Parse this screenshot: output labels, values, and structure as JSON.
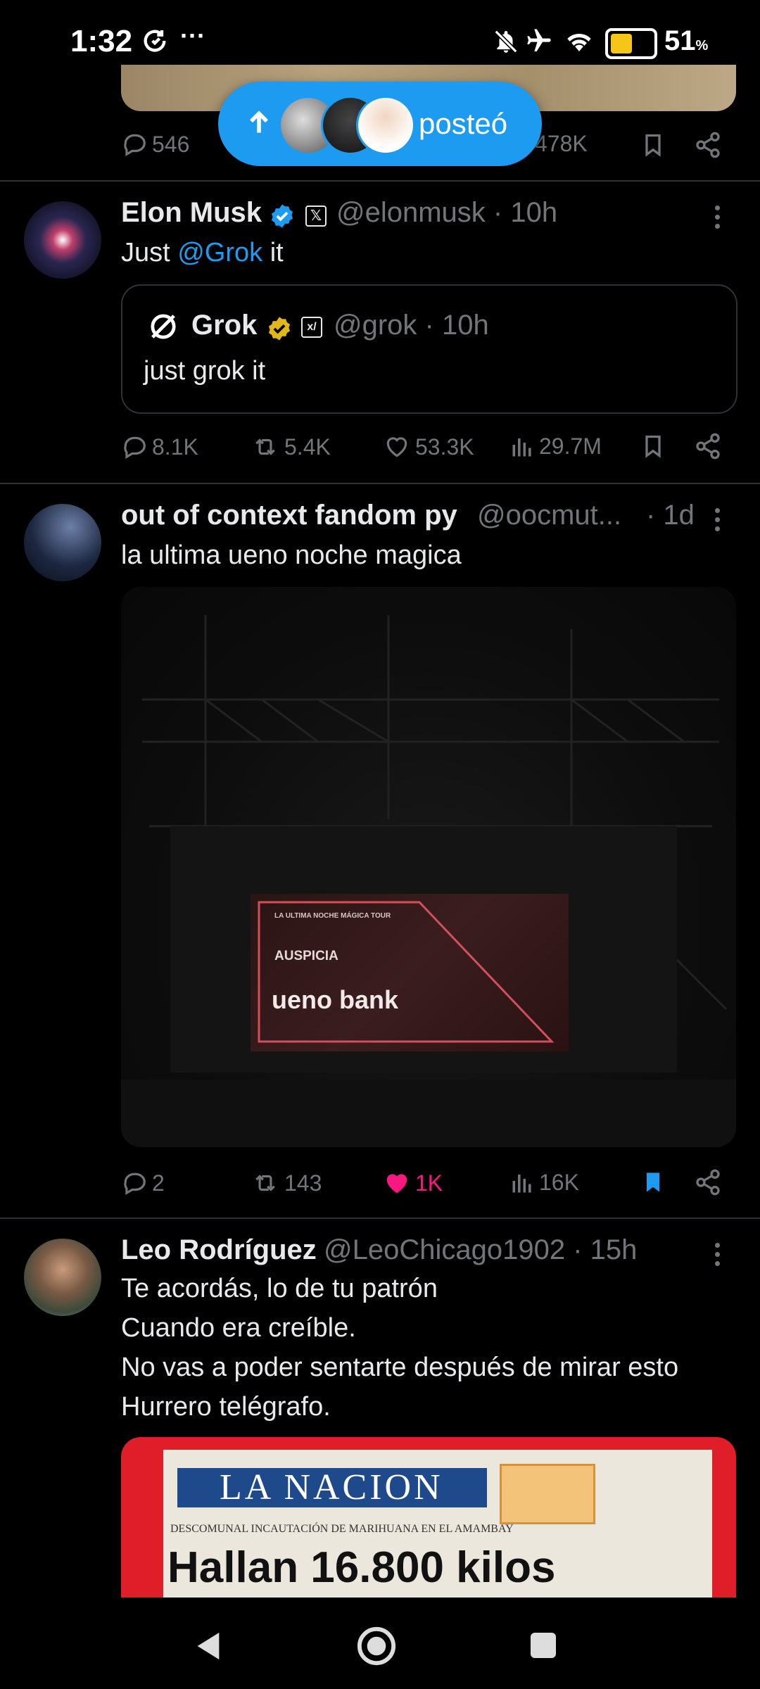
{
  "status_bar": {
    "time": "1:32",
    "more": "···",
    "battery_pct": "51",
    "pct_sign": "%",
    "battery_level": 0.51
  },
  "prev_tweet": {
    "replies": "546",
    "views": "478K"
  },
  "new_posts_pill": {
    "label": "posteó"
  },
  "tweets": [
    {
      "name": "Elon Musk",
      "handle": "@elonmusk · 10h",
      "text_prefix": "Just ",
      "text_link": "@Grok",
      "text_suffix": " it",
      "quote": {
        "name": "Grok",
        "handle": "@grok · 10h",
        "text": "just grok it"
      },
      "replies": "8.1K",
      "retweets": "5.4K",
      "likes": "53.3K",
      "views": "29.7M"
    },
    {
      "name": "out of context fandom py",
      "handle": "@oocmut...",
      "time": "· 1d",
      "text": "la ultima ueno noche magica",
      "media": {
        "line1": "LA ULTIMA NOCHE MÁGICA TOUR",
        "line2": "AUSPICIA",
        "line3": "ueno bank"
      },
      "replies": "2",
      "retweets": "143",
      "likes": "1K",
      "views": "16K"
    },
    {
      "name": "Leo Rodríguez",
      "handle": "@LeoChicago1902 · 15h",
      "lines": [
        "Te acordás, lo de tu patrón",
        "Cuando era creíble.",
        "No vas a poder sentarte después de mirar esto",
        "Hurrero telégrafo."
      ],
      "media": {
        "masthead": "LA NACION",
        "subhead": "DESCOMUNAL INCAUTACIÓN DE MARIHUANA EN EL AMAMBAY",
        "headline": "Hallan 16.800 kilos"
      }
    }
  ],
  "colors": {
    "accent": "#1d9bf0",
    "like": "#f91880",
    "muted": "#71767b",
    "text": "#e7e9ea",
    "gold": "#e2b719"
  }
}
